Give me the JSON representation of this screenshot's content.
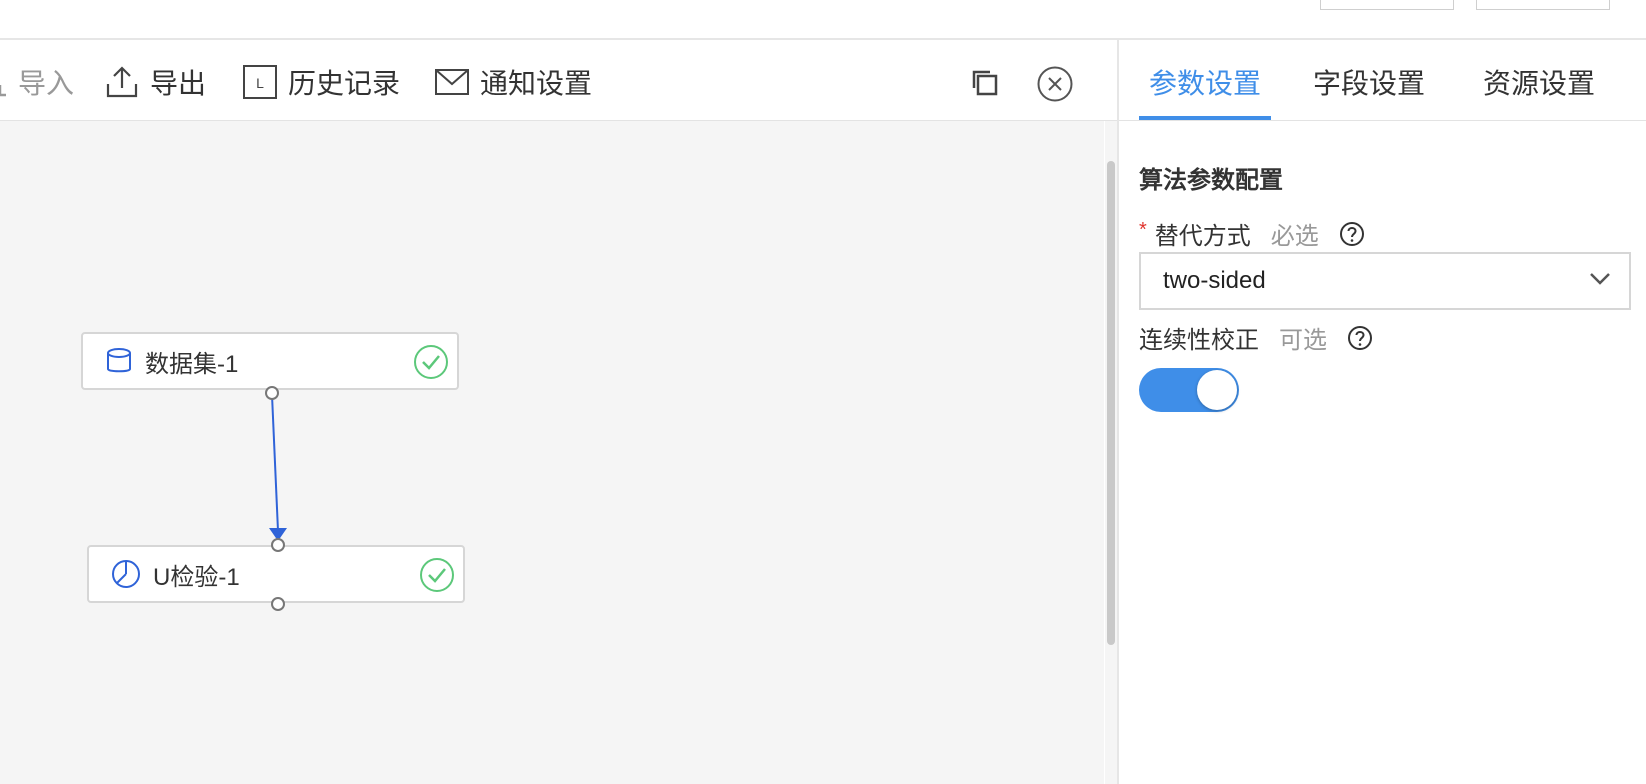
{
  "toolbar": {
    "import_label": "导入",
    "export_label": "导出",
    "history_label": "历史记录",
    "notify_label": "通知设置",
    "history_icon_letter": "L"
  },
  "canvas": {
    "nodes": [
      {
        "label": "数据集-1",
        "icon": "dataset-icon",
        "status": "success"
      },
      {
        "label": "U检验-1",
        "icon": "pie-chart-icon",
        "status": "success"
      }
    ],
    "edge_color": "#2f63d8",
    "success_color": "#5cc87a"
  },
  "panel": {
    "tabs": [
      "参数设置",
      "字段设置",
      "资源设置"
    ],
    "active_tab": 0,
    "section_title": "算法参数配置",
    "fields": {
      "alternative": {
        "required_mark": "*",
        "label": "替代方式",
        "hint": "必选",
        "value": "two-sided"
      },
      "continuity": {
        "label": "连续性校正",
        "hint": "可选",
        "enabled": true
      }
    },
    "accent_color": "#3f8ee8"
  }
}
